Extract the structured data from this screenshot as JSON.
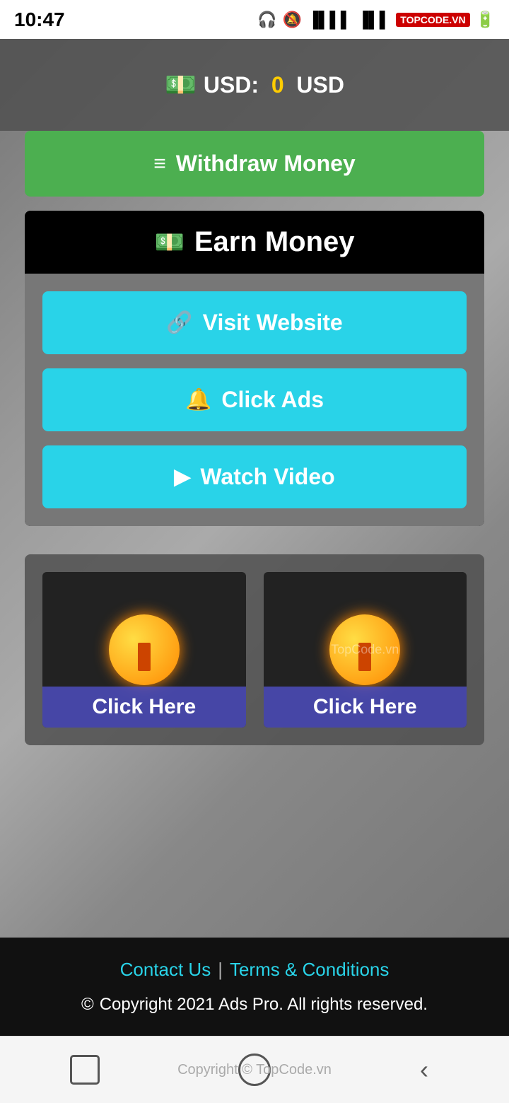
{
  "statusBar": {
    "time": "10:47",
    "icons": "🎧 🔕 📶 📶",
    "badge": "TOPCODE.VN"
  },
  "usd": {
    "label": "USD:",
    "value": "0",
    "suffix": "USD"
  },
  "buttons": {
    "withdraw": "Withdraw Money",
    "visitWebsite": "Visit Website",
    "clickAds": "Click Ads",
    "watchVideo": "Watch Video"
  },
  "earnMoney": {
    "title": "Earn Money"
  },
  "ads": {
    "watermark": "TopCode.vn",
    "card1": "Click Here",
    "card2": "Click Here"
  },
  "footer": {
    "contactUs": "Contact Us",
    "separator": "|",
    "termsConditions": "Terms & Conditions",
    "copyright": "Copyright 2021 Ads Pro. All rights reserved."
  },
  "bottomBar": {
    "copyright": "Copyright © TopCode.vn"
  }
}
